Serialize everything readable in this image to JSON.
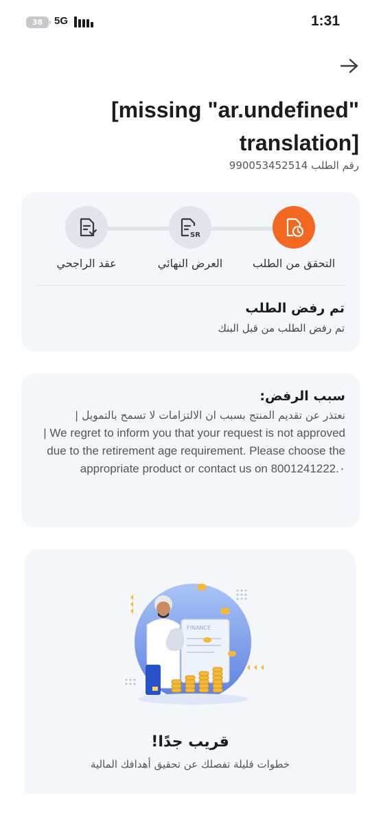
{
  "status_bar": {
    "battery": "38",
    "network": "5G",
    "time": "1:31"
  },
  "header": {
    "title": "[missing \"ar.undefined\" translation]",
    "request_number": "رقم الطلب 990053452514",
    "back_icon": "arrow-right-icon"
  },
  "progress": {
    "steps": [
      {
        "label": "التحقق من الطلب",
        "icon": "clock-document-icon",
        "state": "active"
      },
      {
        "label": "العرض النهائي",
        "icon": "sr-document-icon",
        "state": "inactive"
      },
      {
        "label": "عقد الراجحي",
        "icon": "signed-document-icon",
        "state": "inactive"
      }
    ],
    "status_title": "تم رفض الطلب",
    "status_description": "تم رفض الطلب من قبل البنك",
    "colors": {
      "active": "#f26722",
      "inactive": "#e2e4ea"
    }
  },
  "rejection": {
    "title": "سبب الرفض:",
    "reason_ar": "نعتذر عن تقديم المنتج بسبب ان الالتزامات لا تسمح بالتمويل |",
    "reason_en": "| We regret to inform you that your request is not approved due to the retirement age requirement. Please choose the appropriate product or contact us on 8001241222.٠"
  },
  "promo": {
    "title": "قريب جدًا!",
    "subtitle": "خطوات قليلة تفصلك عن تحقيق أهدافك المالية",
    "illustration_text": "FINANCE"
  }
}
